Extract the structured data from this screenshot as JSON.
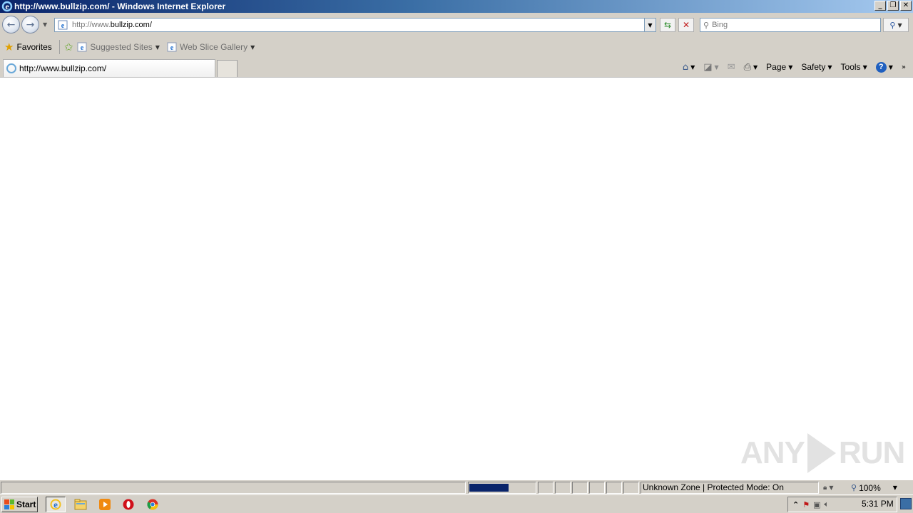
{
  "window": {
    "title": "http://www.bullzip.com/ - Windows Internet Explorer",
    "buttons": [
      "minimize",
      "restore",
      "close"
    ]
  },
  "navigation": {
    "address_prefix": "http://www.",
    "address_domain": "bullzip.com/",
    "search_placeholder": "Bing"
  },
  "favorites_bar": {
    "favorites_label": "Favorites",
    "links": [
      {
        "label": "Suggested Sites"
      },
      {
        "label": "Web Slice Gallery"
      }
    ]
  },
  "tabs": [
    {
      "label": "http://www.bullzip.com/",
      "active": true
    }
  ],
  "command_bar": {
    "page_label": "Page",
    "safety_label": "Safety",
    "tools_label": "Tools"
  },
  "status_bar": {
    "zone_text": "Unknown Zone | Protected Mode: On",
    "zoom": "100%",
    "progress": 0.6
  },
  "taskbar": {
    "start_label": "Start",
    "clock": "5:31 PM"
  },
  "watermark": {
    "text_left": "ANY",
    "text_right": "RUN"
  },
  "colors": {
    "titlebar_start": "#0a246a",
    "titlebar_end": "#a6caf0",
    "chrome": "#d4d0c8",
    "progress_fill": "#0a246a"
  }
}
